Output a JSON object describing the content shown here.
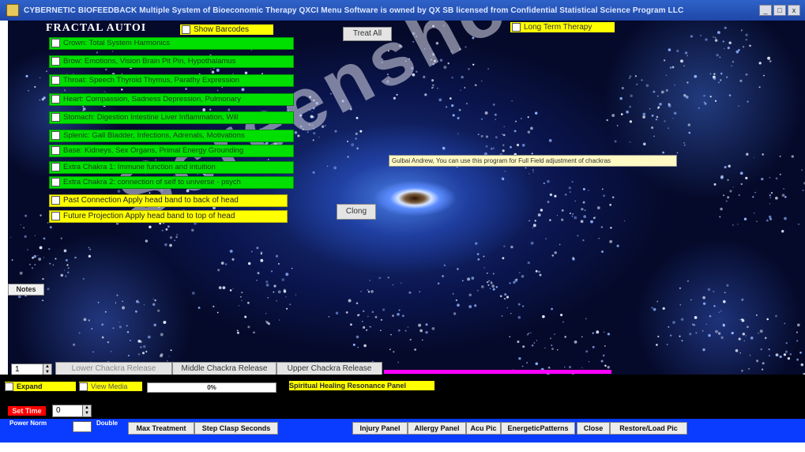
{
  "window": {
    "title": "CYBERNETIC BIOFEEDBACK Multiple System of Bioeconomic Therapy QXCI Menu Software is owned by QX SB licensed from Confidential Statistical Science Program LLC",
    "min_label": "_",
    "max_label": "□",
    "close_label": "x"
  },
  "app": {
    "name": "FRACTAL AUTOI"
  },
  "controls": {
    "show_barcodes": "Show Barcodes",
    "treat_all": "Treat All",
    "long_term_therapy": "Long Term Therapy",
    "clong": "Clong",
    "notes": "Notes"
  },
  "chakra_buttons": [
    "Crown: Total System Harmonics",
    "Brow: Emotions, Vision Brain Pit Pin, Hypothalamus",
    "Throat: Speech Thyroid Thymus, Parathy Expression",
    "Heart: Compassion, Sadness Depression, Pulmonary",
    "Stomach: Digestion Intestine Liver Inflammation, Will",
    "Splenic: Gall Bladder, Infections, Adrenals, Motivations",
    "Base: Kidneys, Sex Organs, Primal Energy Grounding",
    "Extra Chakra 1: Immune function and intuition",
    "Extra Chakra 2: connection of self to universe - psych"
  ],
  "head_band_buttons": [
    "Past Connection Apply head band to back of head",
    "Future Projection  Apply head band to top of head"
  ],
  "tooltip": "Gulbai Andrew, You can use this program for  Full Field adjustment of chackras",
  "watermark": "Screenshot",
  "release_row": {
    "spinner_value": "1",
    "lower": "Lower Chackra Release",
    "middle": "Middle Chackra Release",
    "upper": "Upper Chackra Release"
  },
  "status_row": {
    "expand": "Expand",
    "view_media": "View Media",
    "progress_percent": 0,
    "progress_label": "0%",
    "spiritual": "Spiritual Healing Resonance Panel"
  },
  "time_row": {
    "set_time": "Set Time",
    "time_value": "0"
  },
  "bottom_bar": {
    "power_label": "Power Norm",
    "double_label": "Double",
    "buttons": [
      "Max Treatment",
      "Step Clasp Seconds",
      "Injury Panel",
      "Allergy Panel",
      "Acu Pic",
      "EnergeticPatterns",
      "Close",
      "Restore/Load Pic"
    ]
  },
  "colors": {
    "title_bar": "#1f47a8",
    "fractal_background": "#050a2a",
    "chakra_button": "#00e000",
    "head_band_button": "#ffff00",
    "bottom_bar": "#0a3cff",
    "set_time": "#ff0000",
    "progress_band": "#ff00ff"
  }
}
